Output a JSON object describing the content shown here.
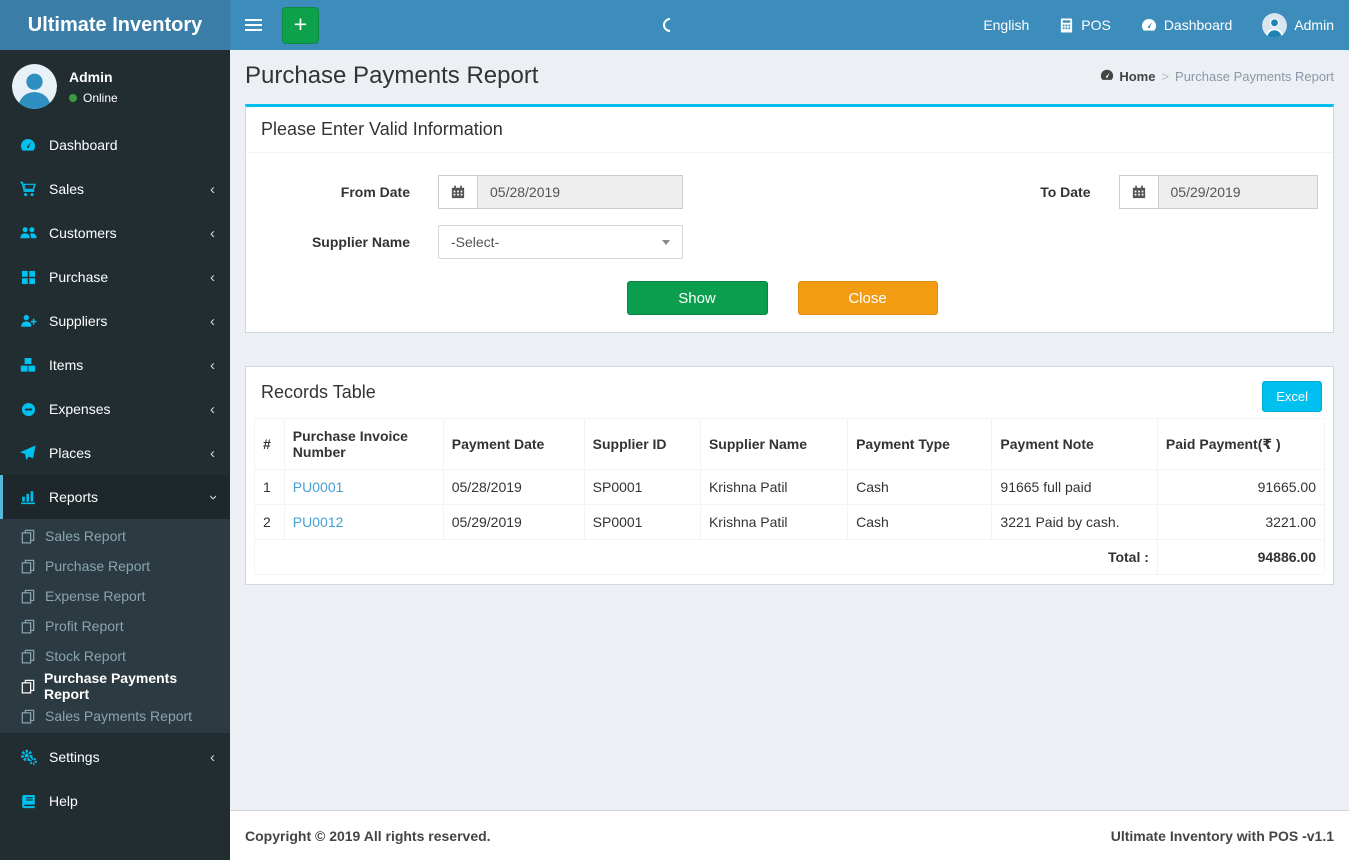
{
  "colors": {
    "navbar": "#3c8dbc",
    "logo_bg": "#3a7ea8",
    "sidebar_bg": "#222d32",
    "submenu_bg": "#2c3b41",
    "accent_cyan": "#00c0ef",
    "success_green": "#0a9e4e",
    "warning_orange": "#f39c12",
    "link_blue": "#459fd4",
    "content_bg": "#ecf0f5",
    "online_dot": "#3c9d40"
  },
  "header": {
    "brand": "Ultimate Inventory",
    "language": "English",
    "pos_label": "POS",
    "dashboard_label": "Dashboard",
    "user_label": "Admin"
  },
  "sidebar": {
    "user_name": "Admin",
    "user_status": "Online",
    "items": [
      {
        "label": "Dashboard"
      },
      {
        "label": "Sales"
      },
      {
        "label": "Customers"
      },
      {
        "label": "Purchase"
      },
      {
        "label": "Suppliers"
      },
      {
        "label": "Items"
      },
      {
        "label": "Expenses"
      },
      {
        "label": "Places"
      },
      {
        "label": "Reports"
      },
      {
        "label": "Settings"
      },
      {
        "label": "Help"
      }
    ],
    "reports_children": [
      {
        "label": "Sales Report"
      },
      {
        "label": "Purchase Report"
      },
      {
        "label": "Expense Report"
      },
      {
        "label": "Profit Report"
      },
      {
        "label": "Stock Report"
      },
      {
        "label": "Purchase Payments Report"
      },
      {
        "label": "Sales Payments Report"
      }
    ]
  },
  "page": {
    "title": "Purchase Payments Report",
    "breadcrumb": {
      "home": "Home",
      "current": "Purchase Payments Report"
    }
  },
  "filter": {
    "title": "Please Enter Valid Information",
    "from": {
      "label": "From Date",
      "value": "05/28/2019"
    },
    "to": {
      "label": "To Date",
      "value": "05/29/2019"
    },
    "supplier": {
      "label": "Supplier Name",
      "value": "-Select-"
    },
    "show_label": "Show",
    "close_label": "Close"
  },
  "records": {
    "title": "Records Table",
    "excel_label": "Excel",
    "columns": [
      "#",
      "Purchase Invoice Number",
      "Payment Date",
      "Supplier ID",
      "Supplier Name",
      "Payment Type",
      "Payment Note",
      "Paid Payment(₹ )"
    ],
    "rows": [
      {
        "num": "1",
        "invoice": "PU0001",
        "date": "05/28/2019",
        "supplier_id": "SP0001",
        "supplier_name": "Krishna Patil",
        "type": "Cash",
        "note": "91665 full paid",
        "paid": "91665.00"
      },
      {
        "num": "2",
        "invoice": "PU0012",
        "date": "05/29/2019",
        "supplier_id": "SP0001",
        "supplier_name": "Krishna Patil",
        "type": "Cash",
        "note": "3221 Paid by cash.",
        "paid": "3221.00"
      }
    ],
    "total_label": "Total :",
    "total_value": "94886.00"
  },
  "footer": {
    "left": "Copyright © 2019 All rights reserved.",
    "right": "Ultimate Inventory with POS -v1.1"
  }
}
